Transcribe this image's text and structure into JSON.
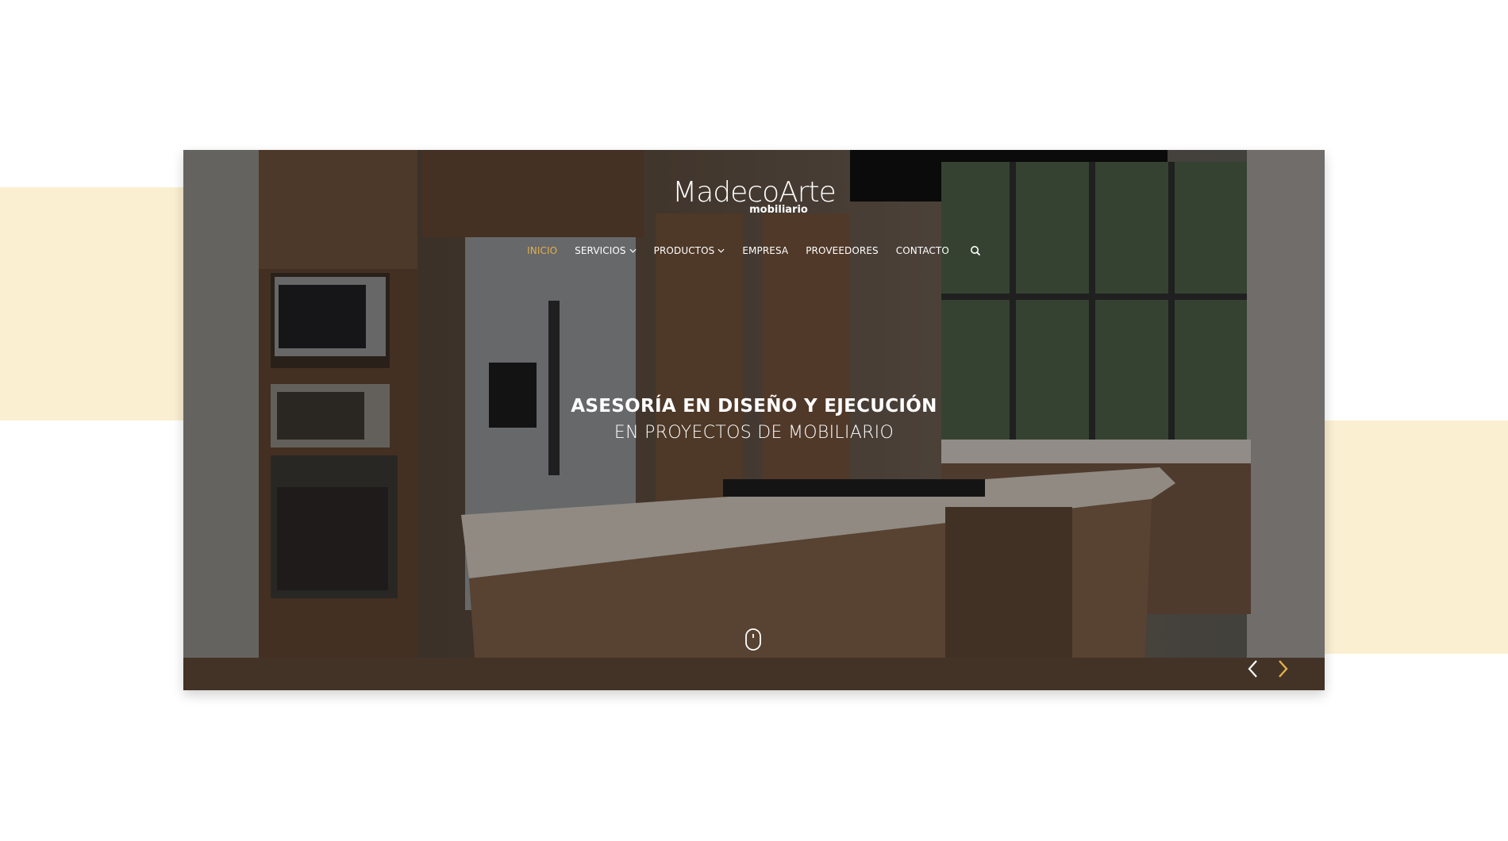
{
  "brand": {
    "name": "MadecoArte",
    "tagline": "mobiliario"
  },
  "nav": {
    "items": [
      {
        "label": "INICIO",
        "active": true,
        "dropdown": false
      },
      {
        "label": "SERVICIOS",
        "active": false,
        "dropdown": true
      },
      {
        "label": "PRODUCTOS",
        "active": false,
        "dropdown": true
      },
      {
        "label": "EMPRESA",
        "active": false,
        "dropdown": false
      },
      {
        "label": "PROVEEDORES",
        "active": false,
        "dropdown": false
      },
      {
        "label": "CONTACTO",
        "active": false,
        "dropdown": false
      }
    ],
    "search_icon": "search-icon"
  },
  "hero": {
    "headline_line1": "ASESORÍA EN DISEÑO Y EJECUCIÓN",
    "headline_line2": "EN PROYECTOS DE MOBILIARIO",
    "scroll_icon": "mouse-scroll-icon",
    "prev_icon": "chevron-left-icon",
    "next_icon": "chevron-right-icon"
  },
  "colors": {
    "accent": "#e2b04a",
    "band": "#fbefd1",
    "nav_text": "#ffffff"
  }
}
